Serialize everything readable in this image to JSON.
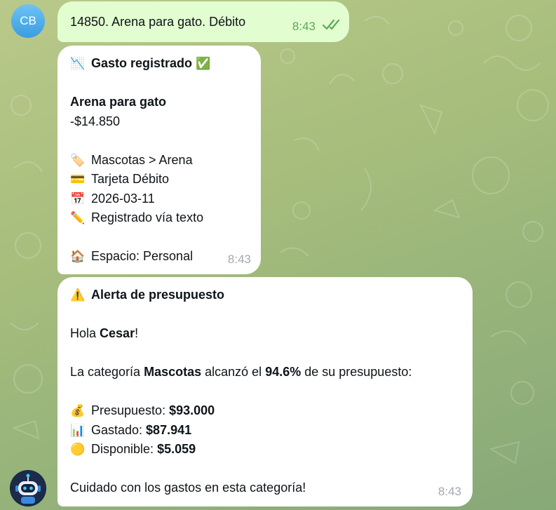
{
  "chat": {
    "user_avatar": "CB",
    "outgoing": {
      "text": "14850. Arena para gato. Débito",
      "time": "8:43",
      "status_icon": "double-check-icon"
    },
    "expense_card": {
      "title_icon": "📉",
      "title": "Gasto registrado",
      "title_badge": "✅",
      "item_name": "Arena para gato",
      "amount": "-$14.850",
      "category_icon": "🏷️",
      "category": "Mascotas > Arena",
      "payment_icon": "💳",
      "payment": "Tarjeta Débito",
      "date_icon": "📅",
      "date": "2026-03-11",
      "source_icon": "✏️",
      "source": "Registrado vía texto",
      "space_icon": "🏠",
      "space": "Espacio: Personal",
      "time": "8:43"
    },
    "budget_alert": {
      "title_icon": "⚠️",
      "title": "Alerta de presupuesto",
      "greeting_prefix": "Hola ",
      "greeting_name": "Cesar",
      "greeting_suffix": "!",
      "line_prefix": "La categoría ",
      "line_category": "Mascotas",
      "line_mid": " alcanzó el ",
      "line_percent": "94.6%",
      "line_suffix": " de su presupuesto:",
      "budget_icon": "💰",
      "budget_label": "Presupuesto: ",
      "budget_value": "$93.000",
      "spent_icon": "📊",
      "spent_label": "Gastado: ",
      "spent_value": "$87.941",
      "available_icon": "🟡",
      "available_label": "Disponible: ",
      "available_value": "$5.059",
      "footer": "Cuidado con los gastos en esta categoría!",
      "time": "8:43"
    }
  },
  "colors": {
    "outgoing_bubble": "#e2fdd0",
    "incoming_bubble": "#ffffff",
    "wallpaper": "#a6bd7c",
    "read_ticks": "#5fa857"
  }
}
